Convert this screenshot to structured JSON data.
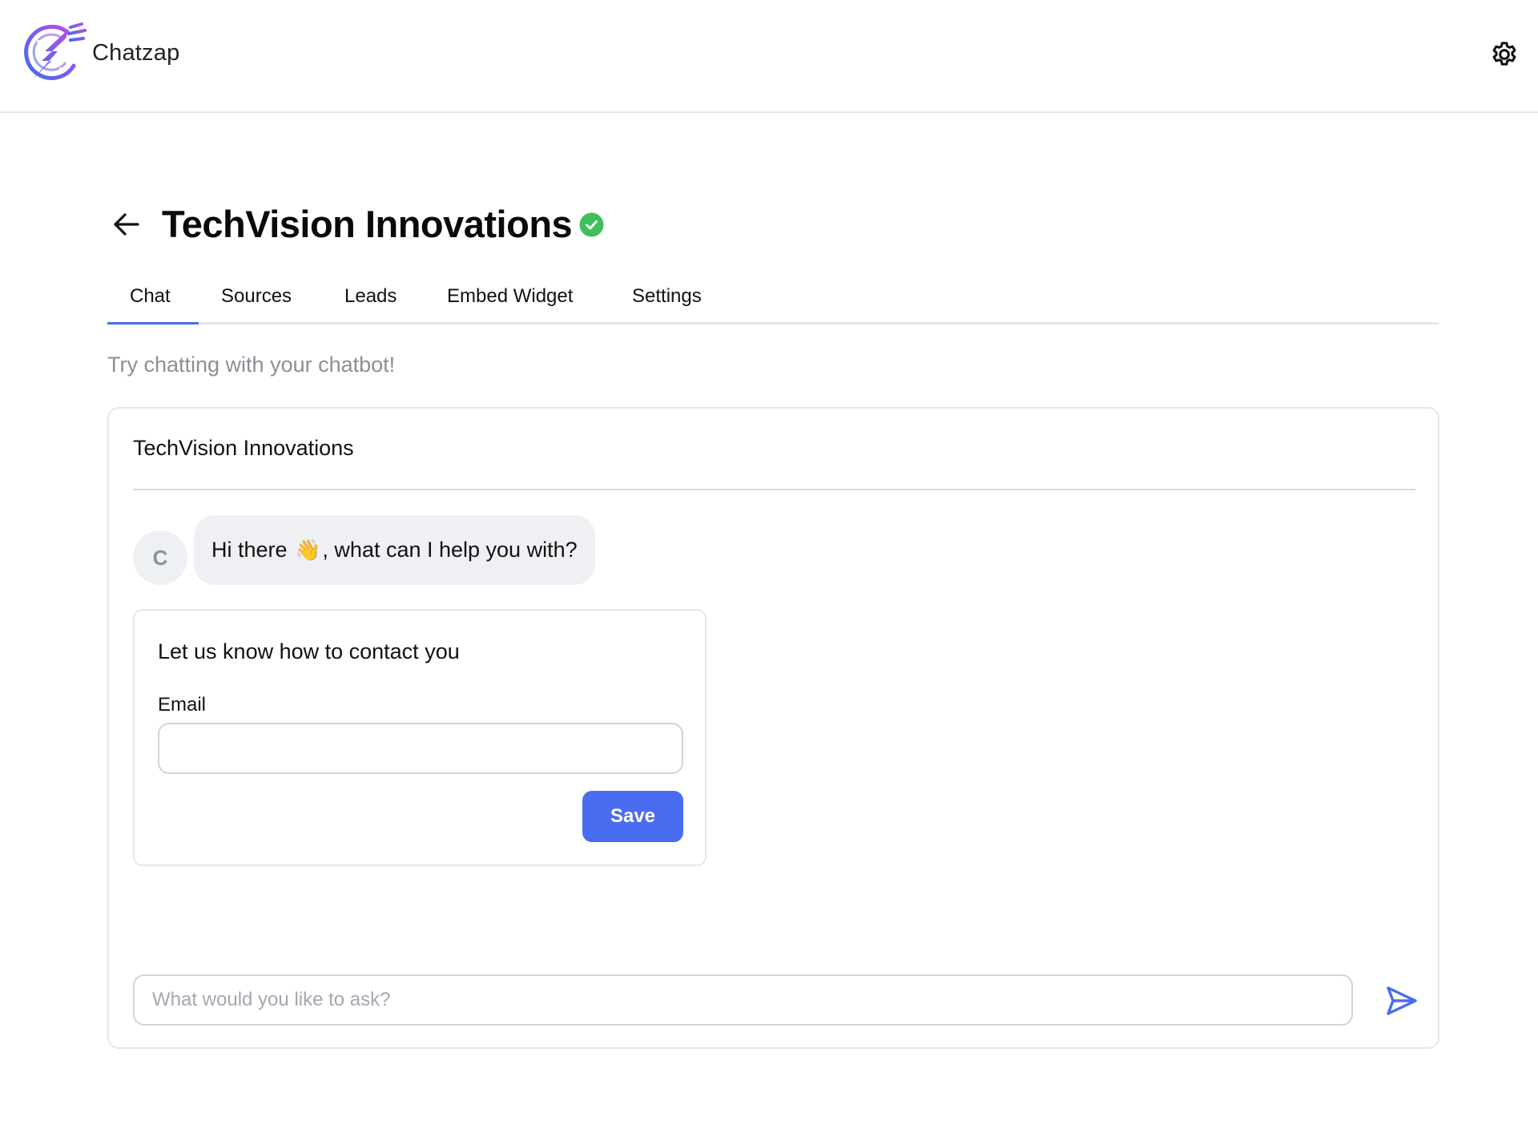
{
  "app": {
    "brand_name": "Chatzap",
    "logo_icon": "chatzap-lightning-logo",
    "settings_icon": "gear-icon"
  },
  "page": {
    "back_icon": "arrow-left-icon",
    "title": "TechVision Innovations",
    "status_icon": "check-circle-icon",
    "status": "verified"
  },
  "tabs": [
    {
      "label": "Chat",
      "active": true
    },
    {
      "label": "Sources",
      "active": false
    },
    {
      "label": "Leads",
      "active": false
    },
    {
      "label": "Embed Widget",
      "active": false
    },
    {
      "label": "Settings",
      "active": false
    }
  ],
  "subtitle": "Try chatting with your chatbot!",
  "chat": {
    "header_title": "TechVision Innovations",
    "messages": [
      {
        "avatar_initial": "C",
        "text_before": "Hi there ",
        "emoji": "👋",
        "text_after": ", what can I help you with?"
      }
    ],
    "contact_form": {
      "title": "Let us know how to contact you",
      "email_label": "Email",
      "email_value": "",
      "email_placeholder": "",
      "save_label": "Save"
    },
    "input": {
      "value": "",
      "placeholder": "What would you like to ask?"
    },
    "send_icon": "paper-plane-send-icon"
  },
  "colors": {
    "accent": "#4a6cf0",
    "verified_green": "#3fbf5a",
    "border": "#e5e7eb",
    "bubble_bg": "#eef0f3",
    "muted_text": "#8a8f98"
  }
}
